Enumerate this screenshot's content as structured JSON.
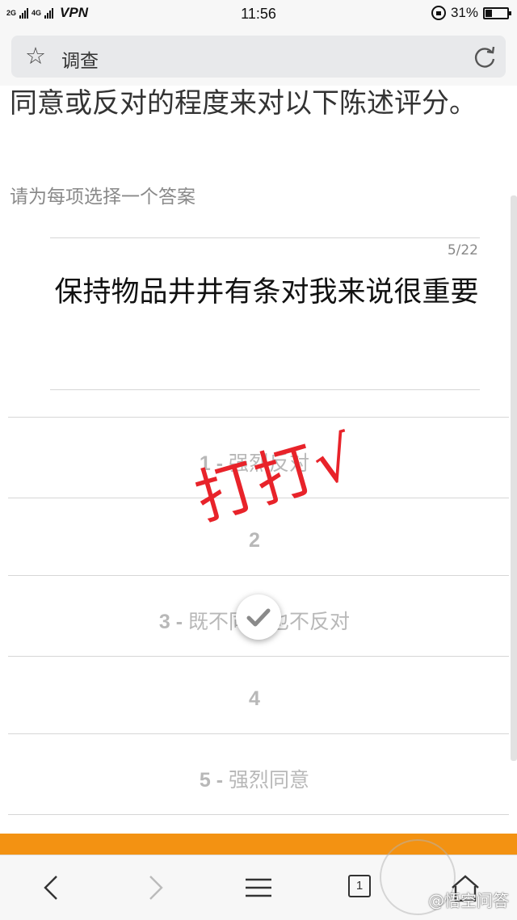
{
  "status_bar": {
    "signal_1": "2G",
    "signal_2": "4G",
    "vpn": "VPN",
    "time": "11:56",
    "battery_pct": "31%",
    "battery_level": 0.31
  },
  "address_bar": {
    "title": "调查"
  },
  "survey": {
    "intro": "同意或反对的程度来对以下陈述评分。",
    "instruction": "请为每项选择一个答案",
    "counter": "5/22",
    "question": "保持物品井井有条对我来说很重要",
    "options": [
      {
        "num": "1 - ",
        "label": "强烈反对"
      },
      {
        "num": "2",
        "label": ""
      },
      {
        "num": "3 - ",
        "label": "既不同意也不反对"
      },
      {
        "num": "4",
        "label": ""
      },
      {
        "num": "5 - ",
        "label": "强烈同意"
      }
    ],
    "selected_index": 2
  },
  "annotation": {
    "handwriting": "打打√",
    "color": "#e8232a"
  },
  "bottom_nav": {
    "tab_count": "1",
    "watermark": "@悟空问答"
  },
  "colors": {
    "accent_orange": "#f39212"
  }
}
